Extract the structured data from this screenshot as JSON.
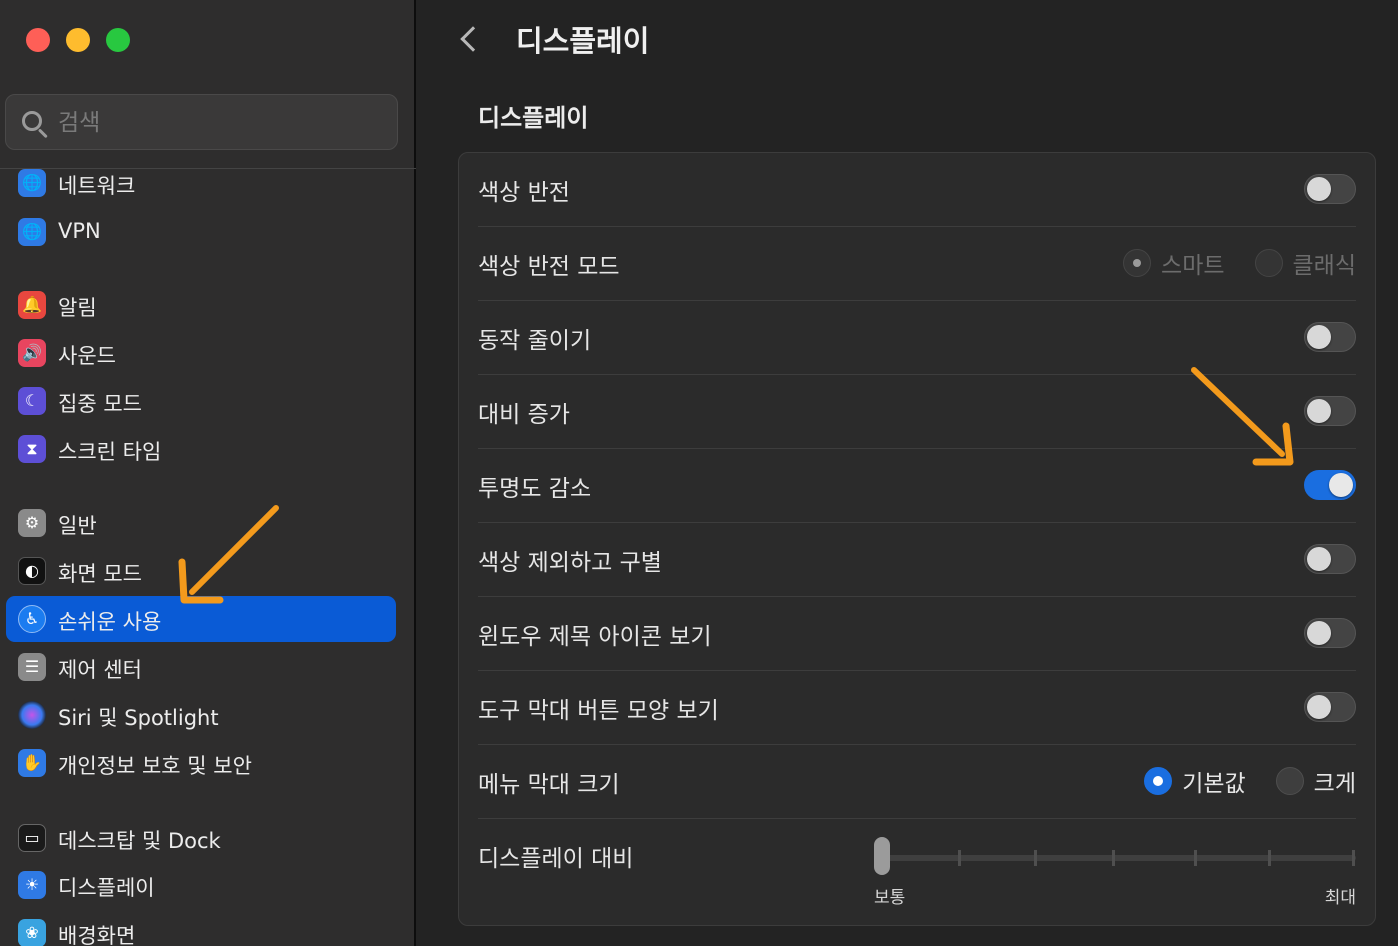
{
  "sidebar": {
    "search_placeholder": "검색",
    "items": [
      {
        "label": "네트워크",
        "icon": "globe-icon",
        "color": "#2f7ae5"
      },
      {
        "label": "VPN",
        "icon": "globe-icon",
        "color": "#2f7ae5"
      },
      {
        "label": "알림",
        "icon": "bell-icon",
        "color": "#e8473f"
      },
      {
        "label": "사운드",
        "icon": "speaker-icon",
        "color": "#e8455f"
      },
      {
        "label": "집중 모드",
        "icon": "moon-icon",
        "color": "#5d4fd6"
      },
      {
        "label": "스크린 타임",
        "icon": "hourglass-icon",
        "color": "#5d4fd6"
      },
      {
        "label": "일반",
        "icon": "gear-icon",
        "color": "#8a8a8a"
      },
      {
        "label": "화면 모드",
        "icon": "appearance-icon",
        "color": "#111111"
      },
      {
        "label": "손쉬운 사용",
        "icon": "accessibility-icon",
        "color": "#1b7cf0"
      },
      {
        "label": "제어 센터",
        "icon": "control-center-icon",
        "color": "#8a8a8a"
      },
      {
        "label": "Siri 및 Spotlight",
        "icon": "siri-icon",
        "color": "#1a1a1a"
      },
      {
        "label": "개인정보 보호 및 보안",
        "icon": "hand-icon",
        "color": "#2f7ae5"
      },
      {
        "label": "데스크탑 및 Dock",
        "icon": "dock-icon",
        "color": "#1a1a1a"
      },
      {
        "label": "디스플레이",
        "icon": "sun-icon",
        "color": "#2f7ae5"
      },
      {
        "label": "배경화면",
        "icon": "flower-icon",
        "color": "#39a3e0"
      }
    ],
    "active_item": "손쉬운 사용"
  },
  "header": {
    "title": "디스플레이"
  },
  "section": {
    "title": "디스플레이"
  },
  "settings": {
    "invert_colors": {
      "label": "색상 반전",
      "on": false
    },
    "invert_mode": {
      "label": "색상 반전 모드",
      "options": [
        "스마트",
        "클래식"
      ],
      "selected": "스마트"
    },
    "reduce_motion": {
      "label": "동작 줄이기",
      "on": false
    },
    "increase_contrast": {
      "label": "대비 증가",
      "on": false
    },
    "reduce_transparency": {
      "label": "투명도 감소",
      "on": true
    },
    "differentiate_without_color": {
      "label": "색상 제외하고 구별",
      "on": false
    },
    "show_window_title_icons": {
      "label": "윈도우 제목 아이콘 보기",
      "on": false
    },
    "show_toolbar_button_shapes": {
      "label": "도구 막대 버튼 모양 보기",
      "on": false
    },
    "menu_bar_size": {
      "label": "메뉴 막대 크기",
      "options": [
        "기본값",
        "크게"
      ],
      "selected": "기본값"
    },
    "display_contrast": {
      "label": "디스플레이 대비",
      "min_label": "보통",
      "max_label": "최대",
      "value": 0
    }
  },
  "colors": {
    "accent": "#1a6ee0",
    "sidebar_active": "#0a5bd6",
    "annotation_arrow": "#f39a1c"
  }
}
